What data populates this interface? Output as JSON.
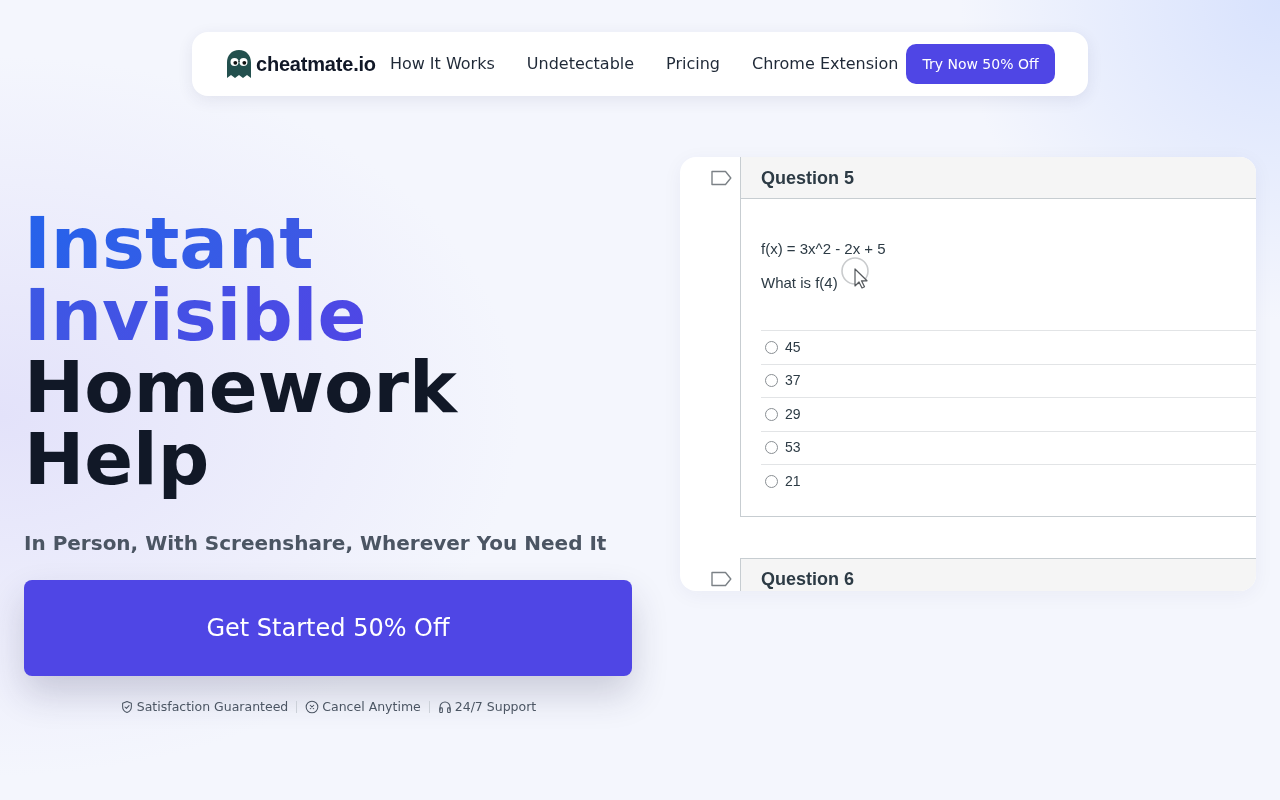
{
  "nav": {
    "brand": "cheatmate.io",
    "links": [
      "How It Works",
      "Undetectable",
      "Pricing",
      "Chrome Extension"
    ],
    "cta": "Try Now 50% Off"
  },
  "hero": {
    "headline": {
      "accent": "Instant Invisible",
      "rest": "Homework Help"
    },
    "subtitle": "In Person, With Screenshare, Wherever You Need It",
    "cta": "Get Started 50% Off",
    "assurances": [
      {
        "kind": "guarantee",
        "text": "Satisfaction Guaranteed"
      },
      {
        "kind": "cancel",
        "text": "Cancel Anytime"
      },
      {
        "kind": "support",
        "text": "24/7 Support"
      }
    ]
  },
  "demo": {
    "questions": [
      {
        "title": "Question 5",
        "lines": [
          "f(x) = 3x^2 - 2x + 5",
          "What is f(4)"
        ],
        "answers": [
          {
            "text": "45",
            "selected": false
          },
          {
            "text": "37",
            "selected": false
          },
          {
            "text": "29",
            "selected": false
          },
          {
            "text": "53",
            "selected": false
          },
          {
            "text": "21",
            "selected": false
          }
        ]
      },
      {
        "title": "Question 6"
      }
    ]
  }
}
